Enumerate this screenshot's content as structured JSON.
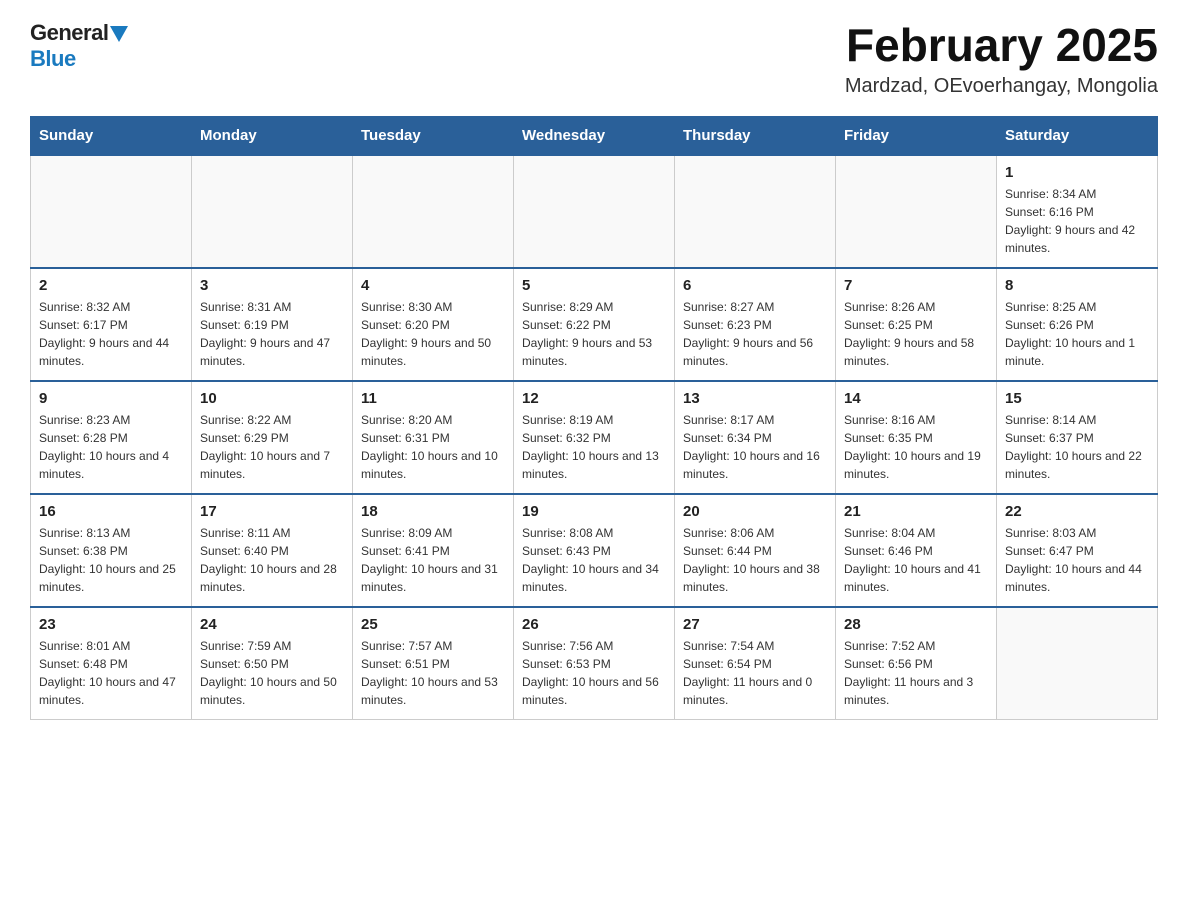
{
  "header": {
    "logo_general": "General",
    "logo_blue": "Blue",
    "month_title": "February 2025",
    "location": "Mardzad, OEvoerhangay, Mongolia"
  },
  "days_of_week": [
    "Sunday",
    "Monday",
    "Tuesday",
    "Wednesday",
    "Thursday",
    "Friday",
    "Saturday"
  ],
  "weeks": [
    [
      {
        "day": "",
        "info": ""
      },
      {
        "day": "",
        "info": ""
      },
      {
        "day": "",
        "info": ""
      },
      {
        "day": "",
        "info": ""
      },
      {
        "day": "",
        "info": ""
      },
      {
        "day": "",
        "info": ""
      },
      {
        "day": "1",
        "info": "Sunrise: 8:34 AM\nSunset: 6:16 PM\nDaylight: 9 hours and 42 minutes."
      }
    ],
    [
      {
        "day": "2",
        "info": "Sunrise: 8:32 AM\nSunset: 6:17 PM\nDaylight: 9 hours and 44 minutes."
      },
      {
        "day": "3",
        "info": "Sunrise: 8:31 AM\nSunset: 6:19 PM\nDaylight: 9 hours and 47 minutes."
      },
      {
        "day": "4",
        "info": "Sunrise: 8:30 AM\nSunset: 6:20 PM\nDaylight: 9 hours and 50 minutes."
      },
      {
        "day": "5",
        "info": "Sunrise: 8:29 AM\nSunset: 6:22 PM\nDaylight: 9 hours and 53 minutes."
      },
      {
        "day": "6",
        "info": "Sunrise: 8:27 AM\nSunset: 6:23 PM\nDaylight: 9 hours and 56 minutes."
      },
      {
        "day": "7",
        "info": "Sunrise: 8:26 AM\nSunset: 6:25 PM\nDaylight: 9 hours and 58 minutes."
      },
      {
        "day": "8",
        "info": "Sunrise: 8:25 AM\nSunset: 6:26 PM\nDaylight: 10 hours and 1 minute."
      }
    ],
    [
      {
        "day": "9",
        "info": "Sunrise: 8:23 AM\nSunset: 6:28 PM\nDaylight: 10 hours and 4 minutes."
      },
      {
        "day": "10",
        "info": "Sunrise: 8:22 AM\nSunset: 6:29 PM\nDaylight: 10 hours and 7 minutes."
      },
      {
        "day": "11",
        "info": "Sunrise: 8:20 AM\nSunset: 6:31 PM\nDaylight: 10 hours and 10 minutes."
      },
      {
        "day": "12",
        "info": "Sunrise: 8:19 AM\nSunset: 6:32 PM\nDaylight: 10 hours and 13 minutes."
      },
      {
        "day": "13",
        "info": "Sunrise: 8:17 AM\nSunset: 6:34 PM\nDaylight: 10 hours and 16 minutes."
      },
      {
        "day": "14",
        "info": "Sunrise: 8:16 AM\nSunset: 6:35 PM\nDaylight: 10 hours and 19 minutes."
      },
      {
        "day": "15",
        "info": "Sunrise: 8:14 AM\nSunset: 6:37 PM\nDaylight: 10 hours and 22 minutes."
      }
    ],
    [
      {
        "day": "16",
        "info": "Sunrise: 8:13 AM\nSunset: 6:38 PM\nDaylight: 10 hours and 25 minutes."
      },
      {
        "day": "17",
        "info": "Sunrise: 8:11 AM\nSunset: 6:40 PM\nDaylight: 10 hours and 28 minutes."
      },
      {
        "day": "18",
        "info": "Sunrise: 8:09 AM\nSunset: 6:41 PM\nDaylight: 10 hours and 31 minutes."
      },
      {
        "day": "19",
        "info": "Sunrise: 8:08 AM\nSunset: 6:43 PM\nDaylight: 10 hours and 34 minutes."
      },
      {
        "day": "20",
        "info": "Sunrise: 8:06 AM\nSunset: 6:44 PM\nDaylight: 10 hours and 38 minutes."
      },
      {
        "day": "21",
        "info": "Sunrise: 8:04 AM\nSunset: 6:46 PM\nDaylight: 10 hours and 41 minutes."
      },
      {
        "day": "22",
        "info": "Sunrise: 8:03 AM\nSunset: 6:47 PM\nDaylight: 10 hours and 44 minutes."
      }
    ],
    [
      {
        "day": "23",
        "info": "Sunrise: 8:01 AM\nSunset: 6:48 PM\nDaylight: 10 hours and 47 minutes."
      },
      {
        "day": "24",
        "info": "Sunrise: 7:59 AM\nSunset: 6:50 PM\nDaylight: 10 hours and 50 minutes."
      },
      {
        "day": "25",
        "info": "Sunrise: 7:57 AM\nSunset: 6:51 PM\nDaylight: 10 hours and 53 minutes."
      },
      {
        "day": "26",
        "info": "Sunrise: 7:56 AM\nSunset: 6:53 PM\nDaylight: 10 hours and 56 minutes."
      },
      {
        "day": "27",
        "info": "Sunrise: 7:54 AM\nSunset: 6:54 PM\nDaylight: 11 hours and 0 minutes."
      },
      {
        "day": "28",
        "info": "Sunrise: 7:52 AM\nSunset: 6:56 PM\nDaylight: 11 hours and 3 minutes."
      },
      {
        "day": "",
        "info": ""
      }
    ]
  ]
}
